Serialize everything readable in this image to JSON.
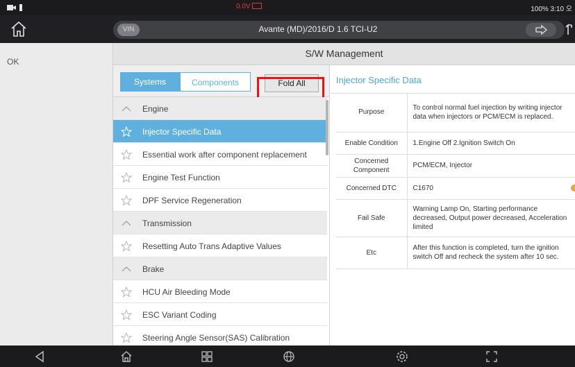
{
  "status_bar": {
    "voltage": "0.0V",
    "right_text": "100% 3:10 오"
  },
  "header": {
    "vin_label": "VIN",
    "vehicle_title": "Avante (MD)/2016/D 1.6 TCI-U2"
  },
  "left_panel": {
    "ok_label": "OK"
  },
  "page": {
    "title": "S/W Management"
  },
  "tabs": {
    "systems": "Systems",
    "components": "Components",
    "fold_all": "Fold All"
  },
  "function_list": [
    {
      "type": "section",
      "label": "Engine"
    },
    {
      "type": "item",
      "label": "Injector Specific Data",
      "selected": true
    },
    {
      "type": "item",
      "label": "Essential work after component replacement"
    },
    {
      "type": "item",
      "label": "Engine Test Function"
    },
    {
      "type": "item",
      "label": "DPF Service Regeneration"
    },
    {
      "type": "section",
      "label": "Transmission"
    },
    {
      "type": "item",
      "label": "Resetting Auto Trans Adaptive Values"
    },
    {
      "type": "section",
      "label": "Brake"
    },
    {
      "type": "item",
      "label": "HCU Air Bleeding Mode"
    },
    {
      "type": "item",
      "label": "ESC Variant Coding"
    },
    {
      "type": "item",
      "label": "Steering Angle Sensor(SAS) Calibration"
    }
  ],
  "detail": {
    "title": "Injector Specific Data",
    "rows": [
      {
        "key": "Purpose",
        "value": "To control normal fuel injection by writing injector data when injectors or PCM/ECM is replaced."
      },
      {
        "key": "Enable Condition",
        "value": "1.Engine Off 2.Ignition Switch On"
      },
      {
        "key": "Concerned Component",
        "value": "PCM/ECM, Injector"
      },
      {
        "key": "Concerned DTC",
        "value": "C1670"
      },
      {
        "key": "Fail Safe",
        "value": "Warning Lamp On, Starting performance decreased, Output power decreased, Acceleration limited"
      },
      {
        "key": "Etc",
        "value": "After this function is completed, turn the ignition switch Off and recheck the system after 10 sec."
      }
    ]
  },
  "colors": {
    "accent_blue": "#5fb0de",
    "highlight_red": "#e8141a",
    "voltage_red": "#e23a3a"
  },
  "icons": [
    "camera-icon",
    "battery-icon",
    "home-icon",
    "forward-arrow-icon",
    "upload-icon",
    "star-icon",
    "chevron-up-icon",
    "back-icon",
    "apps-icon",
    "globe-icon",
    "settings-icon",
    "screenshot-icon"
  ]
}
